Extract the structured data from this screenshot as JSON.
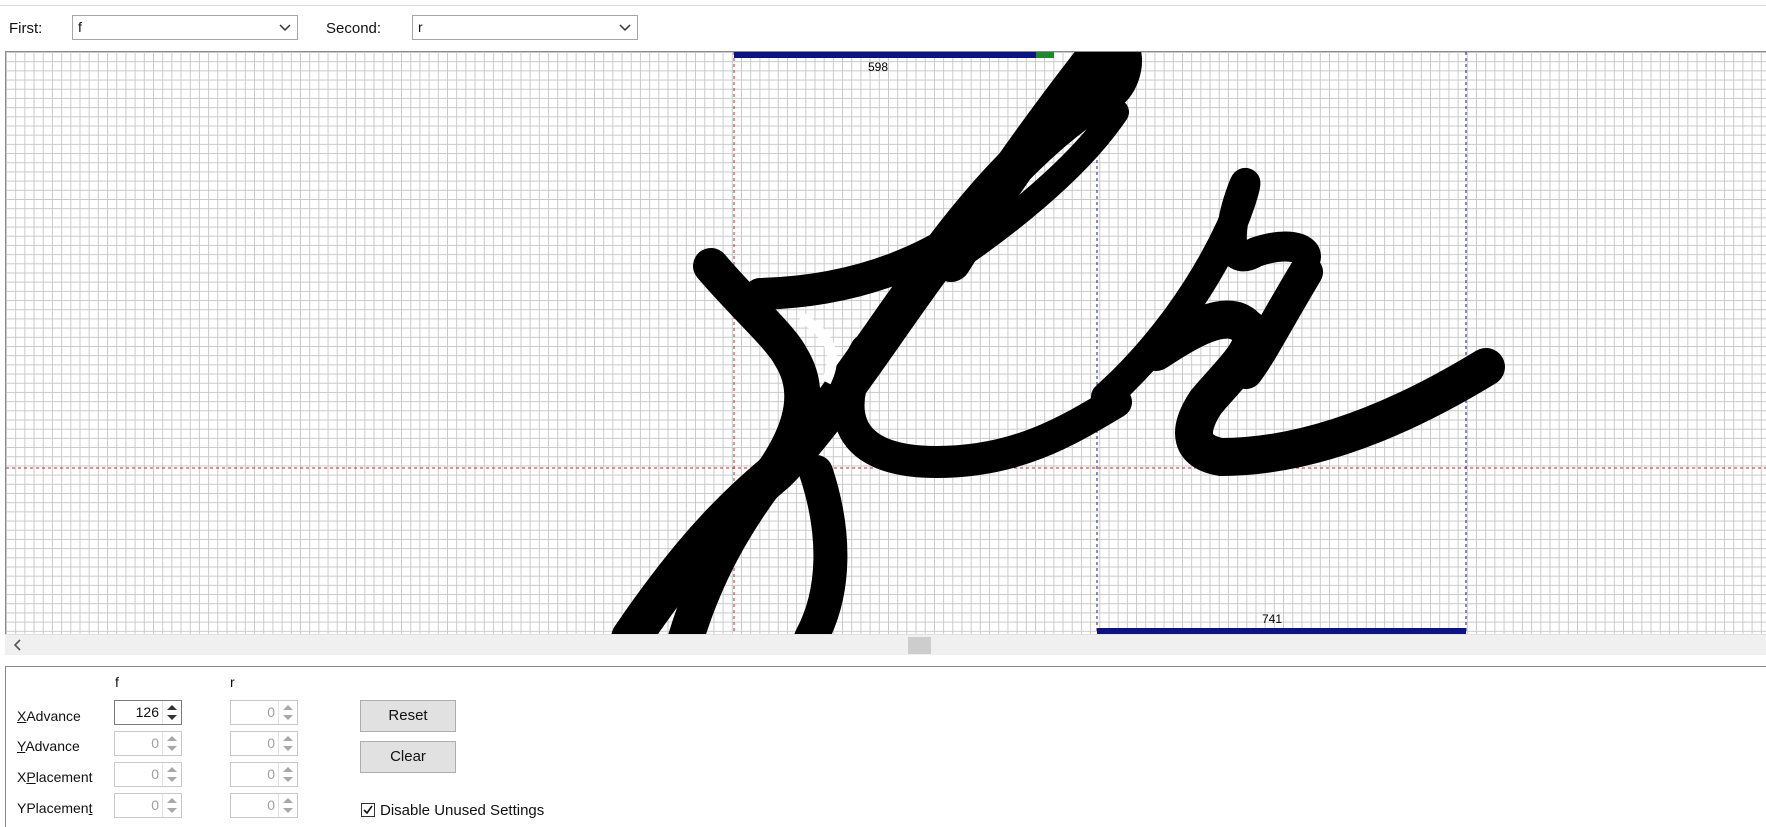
{
  "header": {
    "first_label": "First:",
    "first_value": "f",
    "second_label": "Second:",
    "second_value": "r"
  },
  "canvas": {
    "first_advance_label": "598",
    "second_advance_label": "741",
    "glyph_color": "#000000",
    "advance_bar_color": "#0b1480",
    "kern_bar_color": "#1e8a2a",
    "guide_color_red": "#b03030",
    "guide_color_blue": "#1a1a8c"
  },
  "panel": {
    "col_first": "f",
    "col_second": "r",
    "rows": [
      {
        "label": "XAdvance",
        "mnemonic": "X",
        "rest": "Advance",
        "first": "126",
        "second": "0",
        "enabled": true
      },
      {
        "label": "YAdvance",
        "mnemonic": "Y",
        "rest": "Advance",
        "first": "0",
        "second": "0",
        "enabled": false
      },
      {
        "label": "XPlacement",
        "pre": "X",
        "mnemonic": "P",
        "rest": "lacement",
        "first": "0",
        "second": "0",
        "enabled": false
      },
      {
        "label": "YPlacement",
        "pre": "YPlacemen",
        "mnemonic": "t",
        "rest": "",
        "first": "0",
        "second": "0",
        "enabled": false
      }
    ],
    "reset_label": "Reset",
    "clear_label": "Clear",
    "disable_unused_label": "Disable Unused Settings",
    "disable_unused_checked": true
  },
  "icons": [
    "chevron-down-icon",
    "scroll-left-arrow-icon",
    "spin-up-icon",
    "spin-down-icon",
    "checkmark-icon"
  ]
}
